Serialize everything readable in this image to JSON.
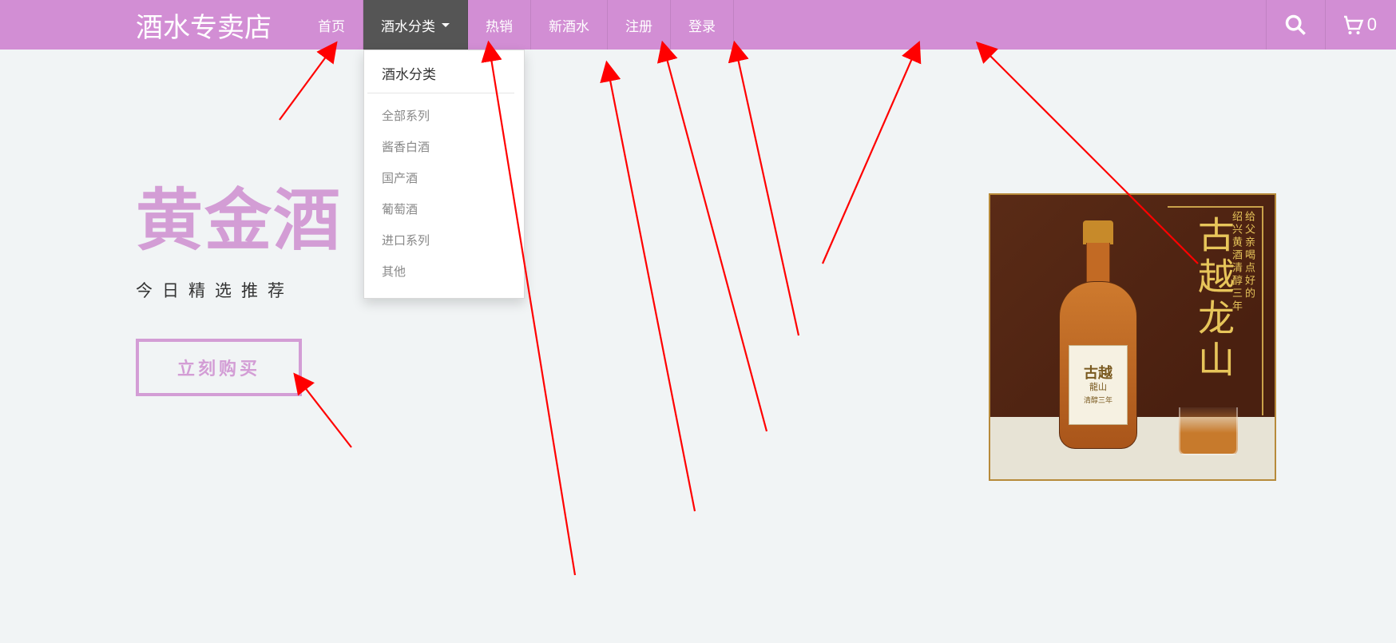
{
  "brand": "酒水专卖店",
  "nav": {
    "items": [
      {
        "label": "首页"
      },
      {
        "label": "酒水分类"
      },
      {
        "label": "热销"
      },
      {
        "label": "新酒水"
      },
      {
        "label": "注册"
      },
      {
        "label": "登录"
      }
    ]
  },
  "dropdown": {
    "title": "酒水分类",
    "items": [
      {
        "label": "全部系列"
      },
      {
        "label": "酱香白酒"
      },
      {
        "label": "国产酒"
      },
      {
        "label": "葡萄酒"
      },
      {
        "label": "进口系列"
      },
      {
        "label": "其他"
      }
    ]
  },
  "cart": {
    "count": "0"
  },
  "hero": {
    "title": "黄金酒",
    "subtitle": "今日精选推荐",
    "button": "立刻购买"
  },
  "product": {
    "vertical_title": "古越龙山",
    "slogan_a": "给父亲喝点好的",
    "slogan_b": "绍兴黄酒清醇三年",
    "label_big": "古越",
    "label_small": "龍山",
    "label_sub": "清醇三年"
  }
}
